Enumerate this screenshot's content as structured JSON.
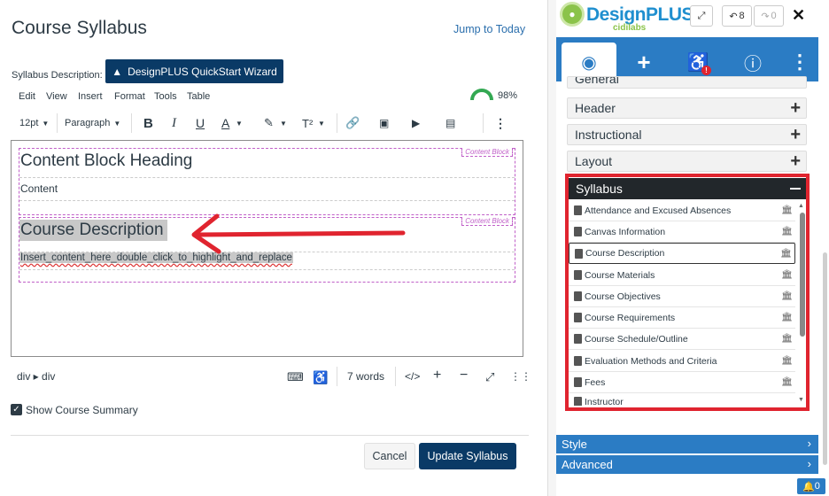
{
  "page": {
    "title": "Course Syllabus",
    "jump_link": "Jump to Today",
    "syllabus_label": "Syllabus Description:",
    "wizard_button": "DesignPLUS QuickStart Wizard"
  },
  "editor": {
    "menu": [
      "Edit",
      "View",
      "Insert",
      "Format",
      "Tools",
      "Table"
    ],
    "accessibility_score": "98%",
    "toolbar": {
      "font_size": "12pt",
      "block_format": "Paragraph"
    },
    "content": {
      "block_tag": "Content Block",
      "heading1": "Content Block Heading",
      "para1": "Content",
      "heading2": "Course Description",
      "para2": "Insert_content_here_double_click_to_highlight_and_replace"
    },
    "status": {
      "path": "div ▸ div",
      "word_count": "7 words"
    }
  },
  "form": {
    "show_summary_label": "Show Course Summary",
    "show_summary_checked": true,
    "cancel": "Cancel",
    "update": "Update Syllabus"
  },
  "panel": {
    "logo_text": "DesignPLUS",
    "logo_sub": "cidilabs",
    "undo_count": "8",
    "redo_count": "0",
    "accordions": [
      "General",
      "Header",
      "Instructional",
      "Layout"
    ],
    "syllabus_title": "Syllabus",
    "syllabus_items": [
      "Attendance and Excused Absences",
      "Canvas Information",
      "Course Description",
      "Course Materials",
      "Course Objectives",
      "Course Requirements",
      "Course Schedule/Outline",
      "Evaluation Methods and Criteria",
      "Fees",
      "Instructor"
    ],
    "selected_item": "Course Description",
    "style_label": "Style",
    "advanced_label": "Advanced",
    "notification_count": "0"
  },
  "colors": {
    "accent_dark": "#0a3a66",
    "panel_blue": "#2b7cc4",
    "highlight_red": "#e0242f",
    "arrow_red": "#e0242f"
  }
}
